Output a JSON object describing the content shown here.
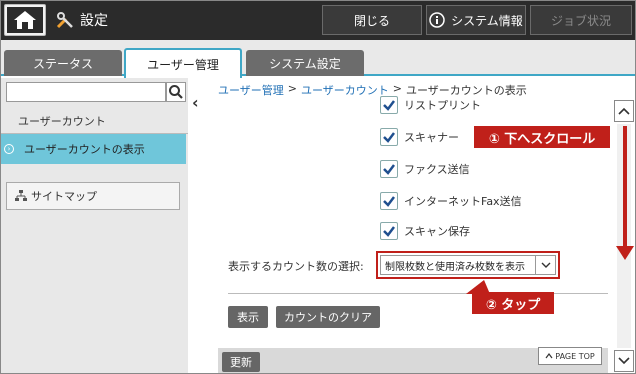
{
  "header": {
    "title": "設定",
    "close_label": "閉じる",
    "sysinfo_label": "システム情報",
    "job_label": "ジョブ状況"
  },
  "tabs": [
    {
      "label": "ステータス"
    },
    {
      "label": "ユーザー管理"
    },
    {
      "label": "システム設定"
    }
  ],
  "sidebar": {
    "search_placeholder": "",
    "group_label": "ユーザーカウント",
    "active_item_label": "ユーザーカウントの表示",
    "sitemap_label": "サイトマップ"
  },
  "breadcrumb": {
    "item1": "ユーザー管理",
    "sep": ">",
    "item2": "ユーザーカウント",
    "current": "ユーザーカウントの表示"
  },
  "checkboxes": [
    {
      "label": "リストプリント",
      "checked": true
    },
    {
      "label": "スキャナー",
      "checked": true
    },
    {
      "label": "ファクス送信",
      "checked": true
    },
    {
      "label": "インターネットFax送信",
      "checked": true
    },
    {
      "label": "スキャン保存",
      "checked": true
    }
  ],
  "count_select": {
    "label": "表示するカウント数の選択:",
    "value": "制限枚数と使用済み枚数を表示"
  },
  "buttons": {
    "show": "表示",
    "clear": "カウントのクリア",
    "update": "更新",
    "page_top": "PAGE TOP"
  },
  "callouts": {
    "scroll": "① 下へスクロール",
    "tap": "② タップ"
  },
  "colors": {
    "accent": "#3fa7c6",
    "active_item": "#6fc6da",
    "callout": "#c0201a",
    "link": "#1f6fb5"
  }
}
